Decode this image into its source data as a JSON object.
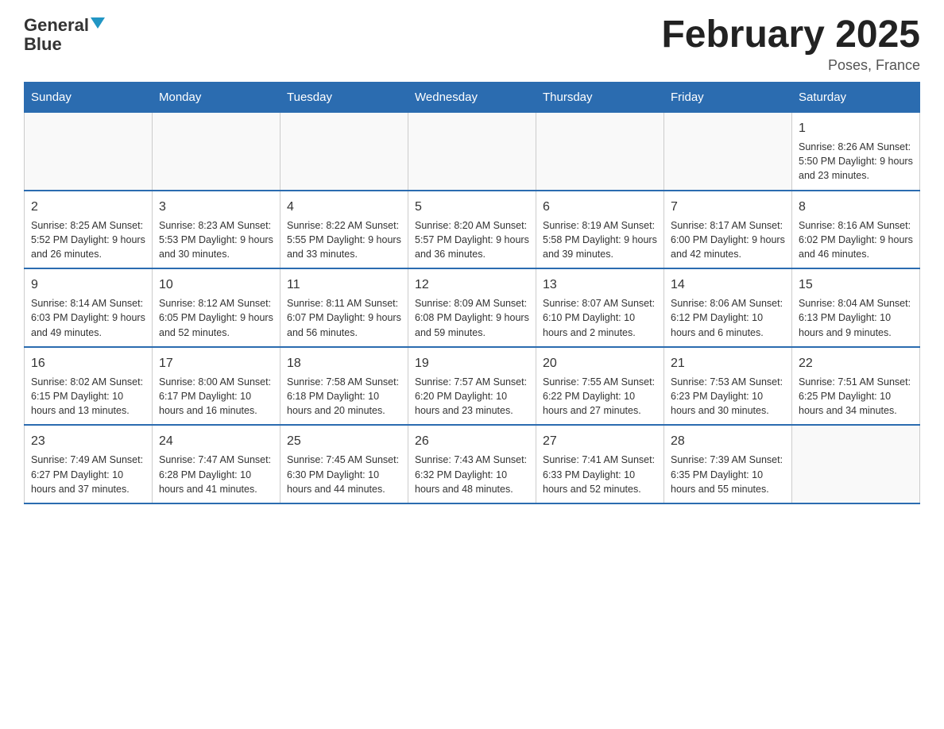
{
  "header": {
    "logo_general": "General",
    "logo_blue": "Blue",
    "month_title": "February 2025",
    "location": "Poses, France"
  },
  "days_of_week": [
    "Sunday",
    "Monday",
    "Tuesday",
    "Wednesday",
    "Thursday",
    "Friday",
    "Saturday"
  ],
  "weeks": [
    {
      "days": [
        {
          "num": "",
          "info": ""
        },
        {
          "num": "",
          "info": ""
        },
        {
          "num": "",
          "info": ""
        },
        {
          "num": "",
          "info": ""
        },
        {
          "num": "",
          "info": ""
        },
        {
          "num": "",
          "info": ""
        },
        {
          "num": "1",
          "info": "Sunrise: 8:26 AM\nSunset: 5:50 PM\nDaylight: 9 hours and 23 minutes."
        }
      ]
    },
    {
      "days": [
        {
          "num": "2",
          "info": "Sunrise: 8:25 AM\nSunset: 5:52 PM\nDaylight: 9 hours and 26 minutes."
        },
        {
          "num": "3",
          "info": "Sunrise: 8:23 AM\nSunset: 5:53 PM\nDaylight: 9 hours and 30 minutes."
        },
        {
          "num": "4",
          "info": "Sunrise: 8:22 AM\nSunset: 5:55 PM\nDaylight: 9 hours and 33 minutes."
        },
        {
          "num": "5",
          "info": "Sunrise: 8:20 AM\nSunset: 5:57 PM\nDaylight: 9 hours and 36 minutes."
        },
        {
          "num": "6",
          "info": "Sunrise: 8:19 AM\nSunset: 5:58 PM\nDaylight: 9 hours and 39 minutes."
        },
        {
          "num": "7",
          "info": "Sunrise: 8:17 AM\nSunset: 6:00 PM\nDaylight: 9 hours and 42 minutes."
        },
        {
          "num": "8",
          "info": "Sunrise: 8:16 AM\nSunset: 6:02 PM\nDaylight: 9 hours and 46 minutes."
        }
      ]
    },
    {
      "days": [
        {
          "num": "9",
          "info": "Sunrise: 8:14 AM\nSunset: 6:03 PM\nDaylight: 9 hours and 49 minutes."
        },
        {
          "num": "10",
          "info": "Sunrise: 8:12 AM\nSunset: 6:05 PM\nDaylight: 9 hours and 52 minutes."
        },
        {
          "num": "11",
          "info": "Sunrise: 8:11 AM\nSunset: 6:07 PM\nDaylight: 9 hours and 56 minutes."
        },
        {
          "num": "12",
          "info": "Sunrise: 8:09 AM\nSunset: 6:08 PM\nDaylight: 9 hours and 59 minutes."
        },
        {
          "num": "13",
          "info": "Sunrise: 8:07 AM\nSunset: 6:10 PM\nDaylight: 10 hours and 2 minutes."
        },
        {
          "num": "14",
          "info": "Sunrise: 8:06 AM\nSunset: 6:12 PM\nDaylight: 10 hours and 6 minutes."
        },
        {
          "num": "15",
          "info": "Sunrise: 8:04 AM\nSunset: 6:13 PM\nDaylight: 10 hours and 9 minutes."
        }
      ]
    },
    {
      "days": [
        {
          "num": "16",
          "info": "Sunrise: 8:02 AM\nSunset: 6:15 PM\nDaylight: 10 hours and 13 minutes."
        },
        {
          "num": "17",
          "info": "Sunrise: 8:00 AM\nSunset: 6:17 PM\nDaylight: 10 hours and 16 minutes."
        },
        {
          "num": "18",
          "info": "Sunrise: 7:58 AM\nSunset: 6:18 PM\nDaylight: 10 hours and 20 minutes."
        },
        {
          "num": "19",
          "info": "Sunrise: 7:57 AM\nSunset: 6:20 PM\nDaylight: 10 hours and 23 minutes."
        },
        {
          "num": "20",
          "info": "Sunrise: 7:55 AM\nSunset: 6:22 PM\nDaylight: 10 hours and 27 minutes."
        },
        {
          "num": "21",
          "info": "Sunrise: 7:53 AM\nSunset: 6:23 PM\nDaylight: 10 hours and 30 minutes."
        },
        {
          "num": "22",
          "info": "Sunrise: 7:51 AM\nSunset: 6:25 PM\nDaylight: 10 hours and 34 minutes."
        }
      ]
    },
    {
      "days": [
        {
          "num": "23",
          "info": "Sunrise: 7:49 AM\nSunset: 6:27 PM\nDaylight: 10 hours and 37 minutes."
        },
        {
          "num": "24",
          "info": "Sunrise: 7:47 AM\nSunset: 6:28 PM\nDaylight: 10 hours and 41 minutes."
        },
        {
          "num": "25",
          "info": "Sunrise: 7:45 AM\nSunset: 6:30 PM\nDaylight: 10 hours and 44 minutes."
        },
        {
          "num": "26",
          "info": "Sunrise: 7:43 AM\nSunset: 6:32 PM\nDaylight: 10 hours and 48 minutes."
        },
        {
          "num": "27",
          "info": "Sunrise: 7:41 AM\nSunset: 6:33 PM\nDaylight: 10 hours and 52 minutes."
        },
        {
          "num": "28",
          "info": "Sunrise: 7:39 AM\nSunset: 6:35 PM\nDaylight: 10 hours and 55 minutes."
        },
        {
          "num": "",
          "info": ""
        }
      ]
    }
  ]
}
